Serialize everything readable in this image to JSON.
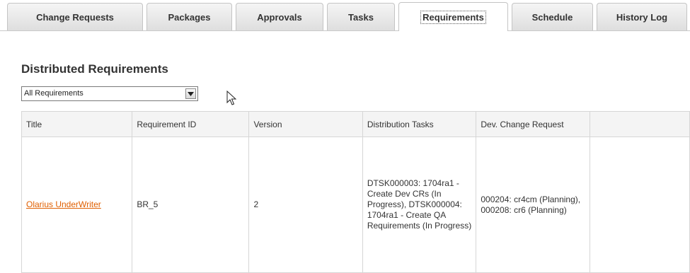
{
  "tabs": [
    {
      "label": "Change Requests",
      "active": false
    },
    {
      "label": "Packages",
      "active": false
    },
    {
      "label": "Approvals",
      "active": false
    },
    {
      "label": "Tasks",
      "active": false
    },
    {
      "label": "Requirements",
      "active": true
    },
    {
      "label": "Schedule",
      "active": false
    },
    {
      "label": "History Log",
      "active": false
    }
  ],
  "section": {
    "title": "Distributed Requirements",
    "filter": {
      "selected": "All Requirements"
    }
  },
  "table": {
    "columns": [
      "Title",
      "Requirement ID",
      "Version",
      "Distribution Tasks",
      "Dev. Change Request",
      ""
    ],
    "rows": [
      {
        "title": "Olarius UnderWriter",
        "requirement_id": "BR_5",
        "version": "2",
        "distribution_tasks": "DTSK000003: 1704ra1 - Create Dev CRs (In Progress), DTSK000004: 1704ra1 - Create QA Requirements (In Progress)",
        "dev_change_request": "000204: cr4cm (Planning), 000208: cr6 (Planning)",
        "extra": ""
      }
    ]
  },
  "colors": {
    "link": "#e05f00",
    "tab_border": "#c4c4c4",
    "grid_border": "#d6d6d6"
  }
}
